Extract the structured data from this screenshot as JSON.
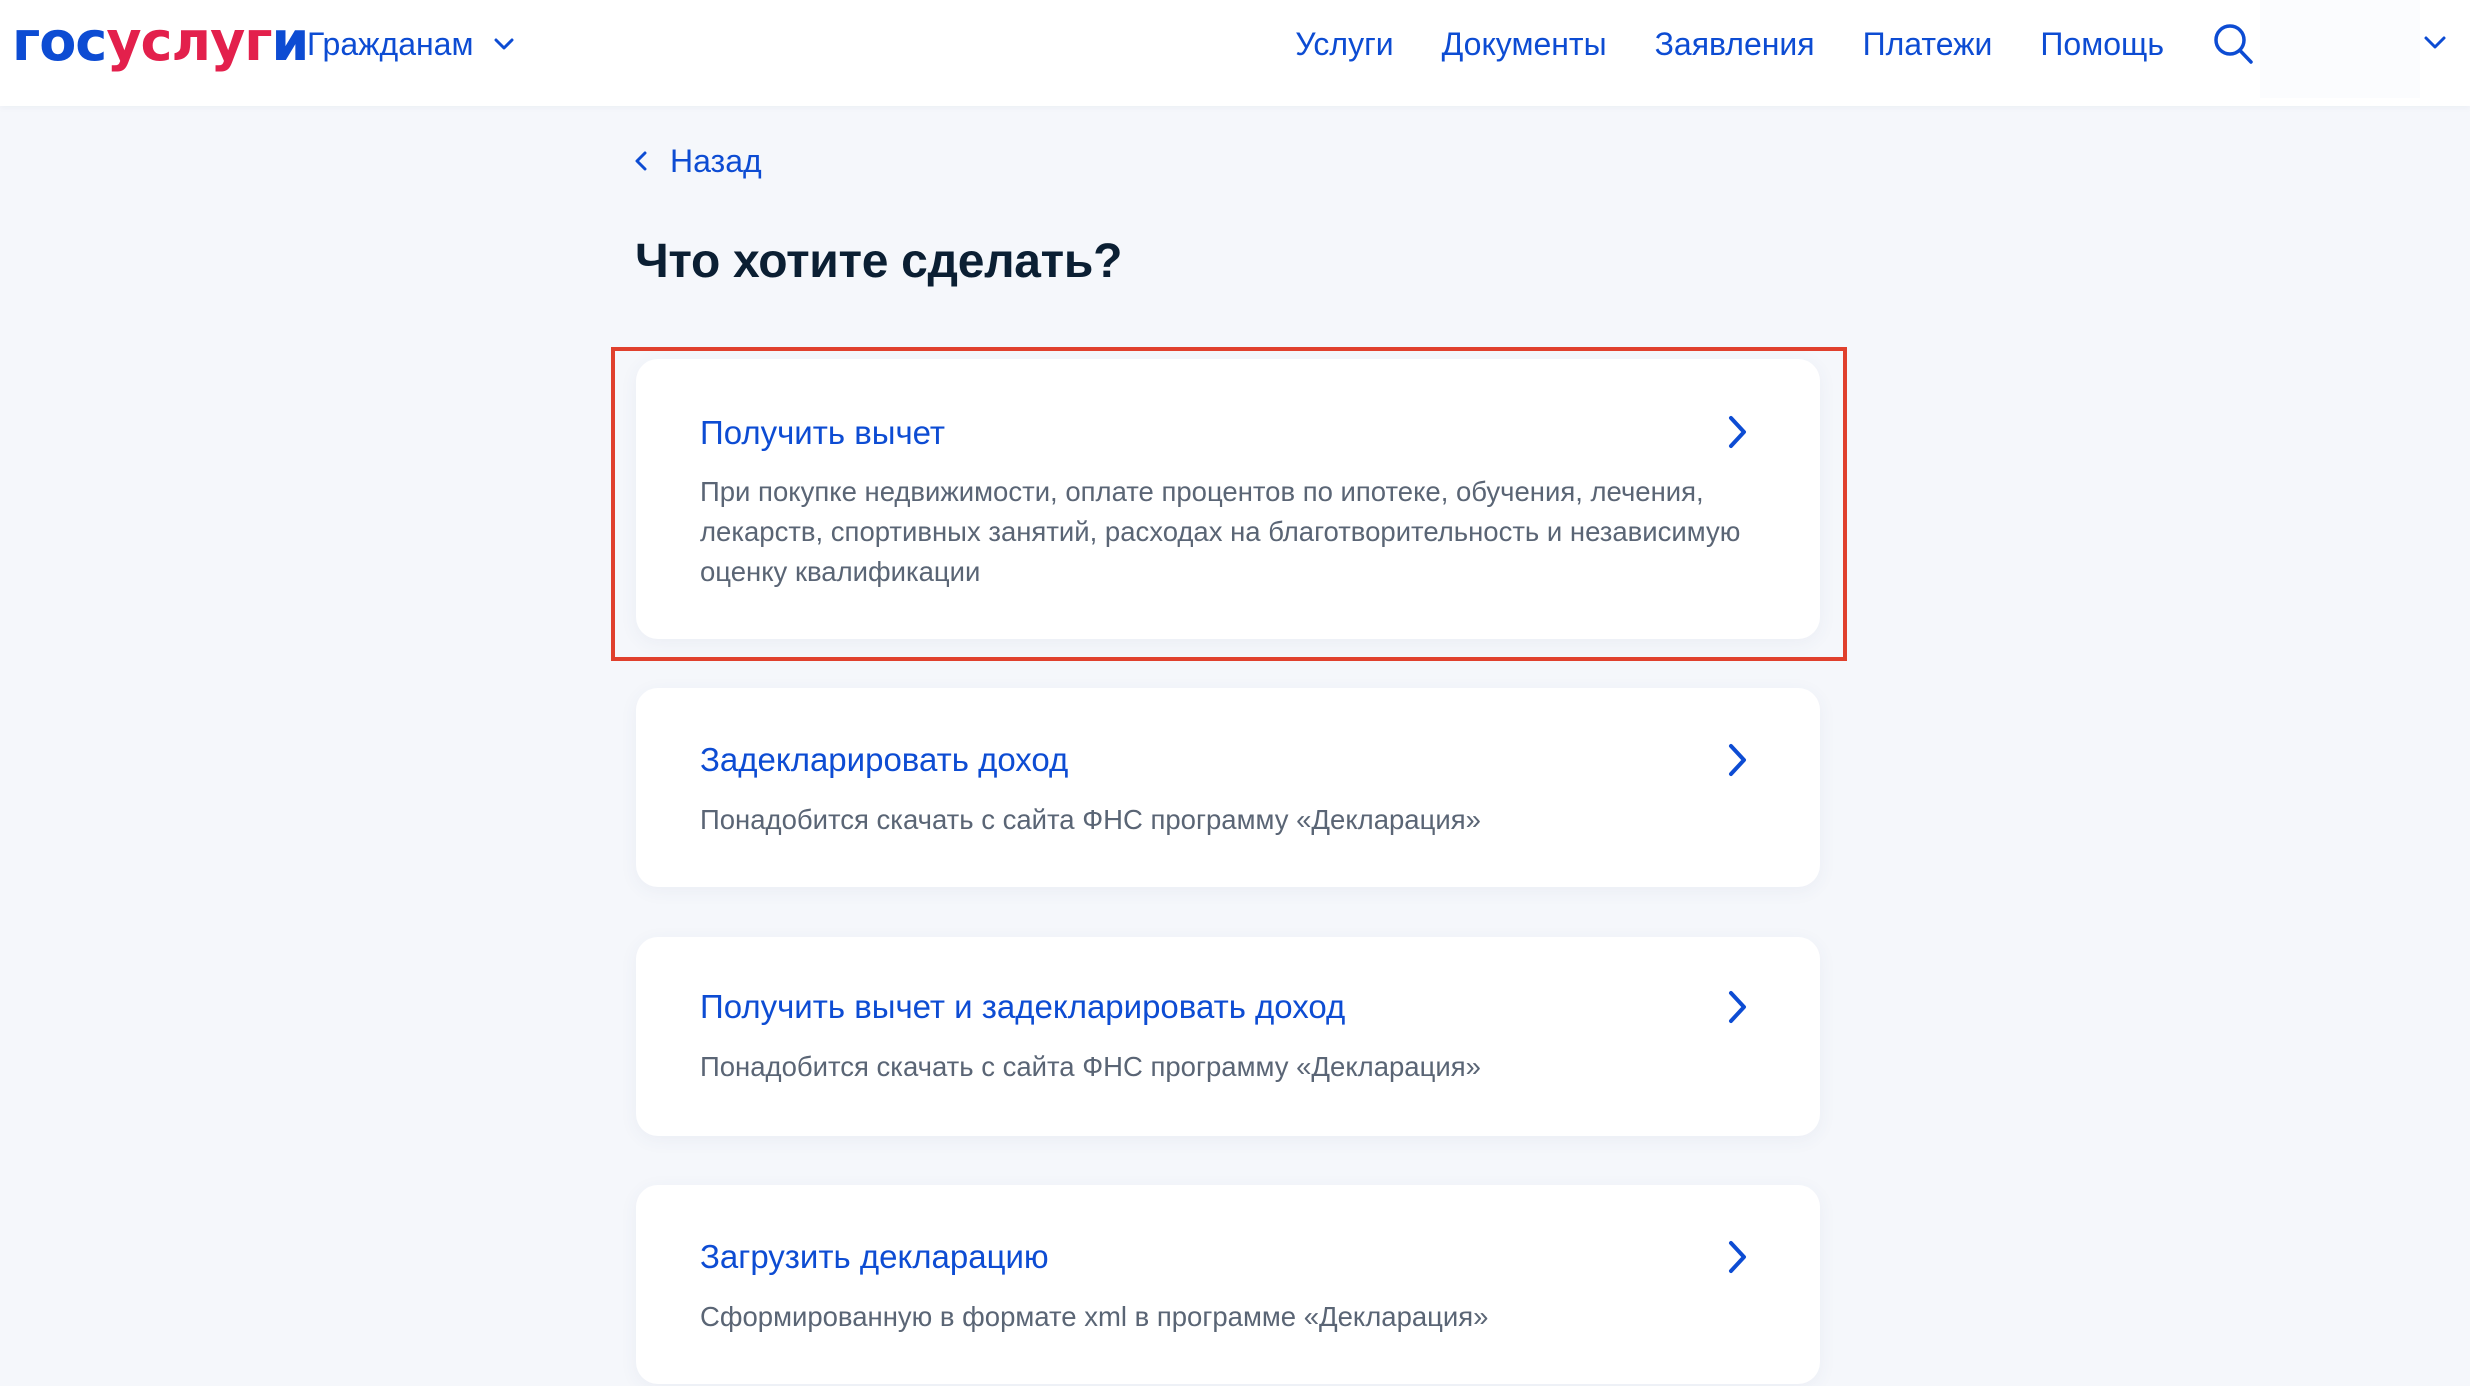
{
  "header": {
    "logo": {
      "part1": "гос",
      "part2": "услуг",
      "part3": "и"
    },
    "audience_label": "Гражданам",
    "nav": [
      "Услуги",
      "Документы",
      "Заявления",
      "Платежи",
      "Помощь"
    ]
  },
  "back_label": "Назад",
  "page_title": "Что хотите сделать?",
  "options": [
    {
      "title": "Получить вычет",
      "description": "При покупке недвижимости, оплате процентов по ипотеке, обучения, лечения, лекарств, спортивных занятий, расходах на благотворительность и независимую оценку квалификации"
    },
    {
      "title": "Задекларировать доход",
      "description": "Понадобится скачать с сайта ФНС программу «Декларация»"
    },
    {
      "title": "Получить вычет и задекларировать доход",
      "description": "Понадобится скачать с сайта ФНС программу «Декларация»"
    },
    {
      "title": "Загрузить декларацию",
      "description": "Сформированную в формате xml в программе «Декларация»"
    }
  ],
  "colors": {
    "brand_blue": "#0d4cd3",
    "brand_red": "#e3204c",
    "title_text": "#0b1f33",
    "muted_text": "#5a6575",
    "background": "#f5f7fb",
    "highlight": "#e0402d"
  }
}
